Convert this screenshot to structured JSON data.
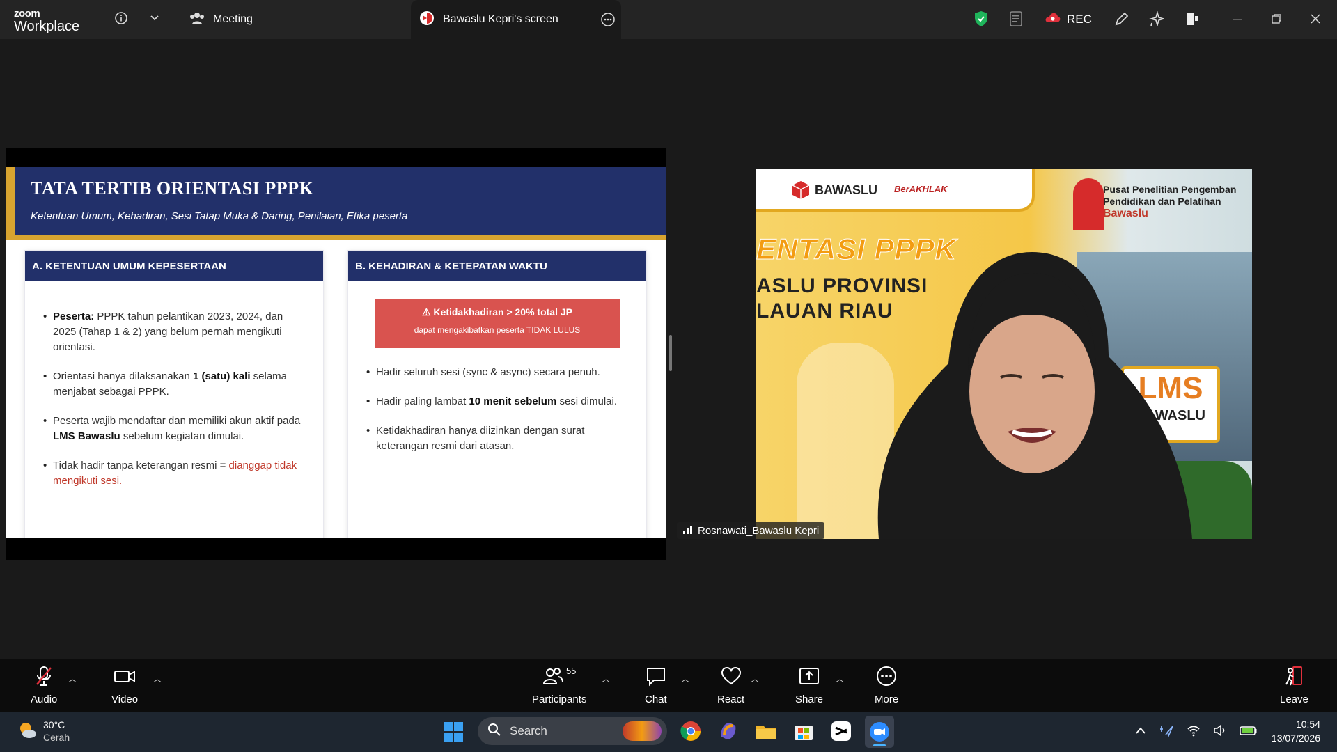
{
  "app": {
    "brand_small": "zoom",
    "brand_large": "Workplace"
  },
  "tabs": [
    {
      "label": "Meeting"
    },
    {
      "label": "Bawaslu Kepri's screen"
    }
  ],
  "titlebar": {
    "rec_label": "REC"
  },
  "slide": {
    "title": "TATA TERTIB ORIENTASI PPPK",
    "subtitle": "Ketentuan Umum, Kehadiran, Sesi Tatap Muka & Daring, Penilaian, Etika peserta",
    "col_a": {
      "heading": "A. KETENTUAN UMUM KEPESERTAAN",
      "b1_bold": "Peserta:",
      "b1_text": " PPPK tahun pelantikan 2023, 2024, dan 2025 (Tahap 1 & 2) yang belum pernah mengikuti orientasi.",
      "b2_pre": "Orientasi hanya dilaksanakan ",
      "b2_bold": "1 (satu) kali",
      "b2_post": " selama menjabat sebagai PPPK.",
      "b3_pre": "Peserta wajib mendaftar dan memiliki akun aktif pada ",
      "b3_bold": "LMS Bawaslu",
      "b3_post": " sebelum kegiatan dimulai.",
      "b4_pre": "Tidak hadir tanpa keterangan resmi = ",
      "b4_red": "dianggap tidak mengikuti sesi."
    },
    "col_b": {
      "heading": "B. KEHADIRAN & KETEPATAN WAKTU",
      "warn_title": "⚠ Ketidakhadiran > 20% total JP",
      "warn_sub": "dapat mengakibatkan peserta TIDAK LULUS",
      "b1": "Hadir seluruh sesi (sync & async) secara penuh.",
      "b2_pre": "Hadir paling lambat ",
      "b2_bold": "10 menit sebelum",
      "b2_post": " sesi dimulai.",
      "b3": "Ketidakhadiran hanya diizinkan dengan surat keterangan resmi dari atasan."
    }
  },
  "video": {
    "bawaslu": "BAWASLU",
    "berakhlak": "BerAKHLAK",
    "pusat_1": "Pusat Penelitian Pengemban",
    "pusat_2": "Pendidikan dan Pelatihan",
    "pusat_3": "Bawaslu",
    "bg_title": "ENTASI PPPK",
    "bg_line1": "ASLU PROVINSI",
    "bg_line2": "LAUAN RIAU",
    "lms": "LMS",
    "lms_sub": "BAWASLU",
    "participant_name": "Rosnawati_Bawaslu Kepri"
  },
  "toolbar": {
    "audio": "Audio",
    "video": "Video",
    "participants": "Participants",
    "participants_count": "55",
    "chat": "Chat",
    "react": "React",
    "share": "Share",
    "more": "More",
    "leave": "Leave"
  },
  "taskbar": {
    "temp": "30°C",
    "weather": "Cerah",
    "search": "Search",
    "time": "10:54",
    "date": "13/07/2026"
  },
  "colors": {
    "slide_navy": "#22306a",
    "slide_gold": "#d8a430",
    "warn_red": "#d9534f",
    "leave_red": "#e0303c"
  }
}
